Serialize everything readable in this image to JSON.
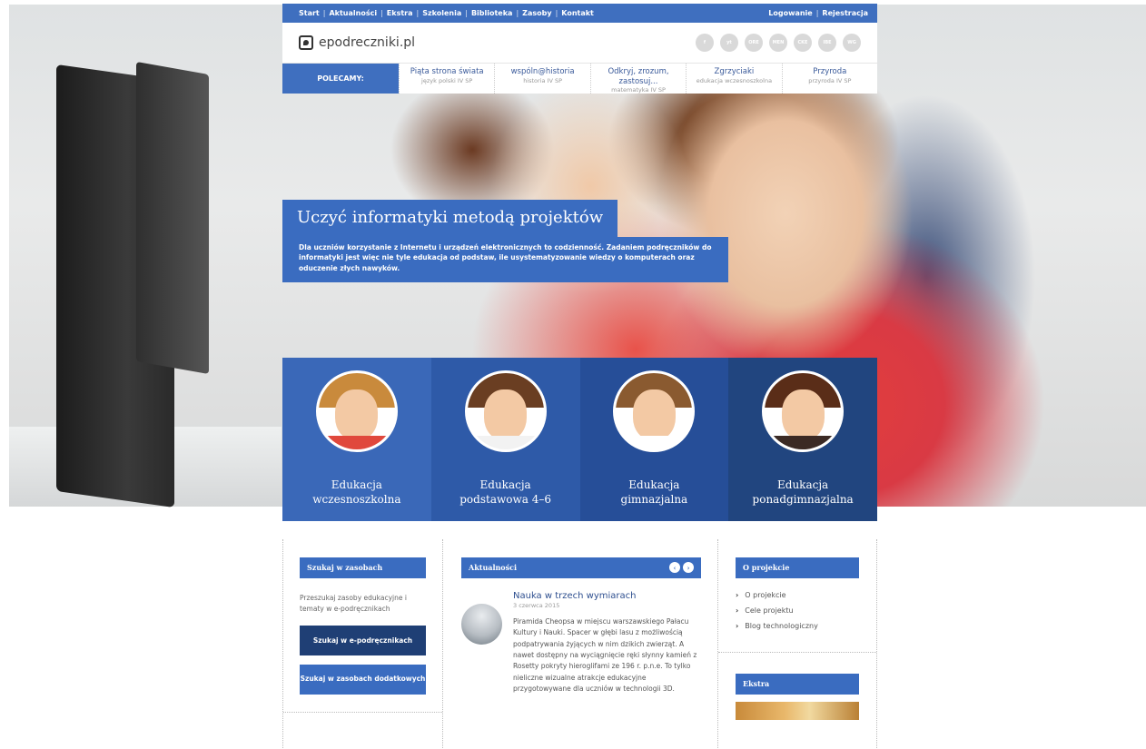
{
  "topbar": {
    "nav": [
      "Start",
      "Aktualności",
      "Ekstra",
      "Szkolenia",
      "Biblioteka",
      "Zasoby",
      "Kontakt"
    ],
    "separator": "|",
    "login": "Logowanie",
    "register": "Rejestracja"
  },
  "header": {
    "logo": "epodreczniki.pl",
    "social": [
      "f",
      "yt",
      "ORE",
      "MEN",
      "CKE",
      "IBE",
      "WG"
    ]
  },
  "recommend": {
    "label": "POLECAMY:",
    "items": [
      {
        "title": "Piąta strona świata",
        "sub": "język polski IV SP"
      },
      {
        "title": "wspóln@historia",
        "sub": "historia IV SP"
      },
      {
        "title": "Odkryj, zrozum, zastosuj...",
        "sub": "matematyka IV SP"
      },
      {
        "title": "Zgrzyciaki",
        "sub": "edukacja wczesnoszkolna"
      },
      {
        "title": "Przyroda",
        "sub": "przyroda IV SP"
      }
    ]
  },
  "hero": {
    "headline": "Uczyć informatyki metodą projektów",
    "lead": "Dla uczniów korzystanie z Internetu i urządzeń elektronicznych to codzienność. Zadaniem podręczników do informatyki jest więc nie tyle edukacja od podstaw, ile usystematyzowanie wiedzy o komputerach oraz oduczenie złych nawyków."
  },
  "education": [
    {
      "line1": "Edukacja",
      "line2": "wczesnoszkolna",
      "hair": "#c98a3c",
      "shirt": "#e0483c"
    },
    {
      "line1": "Edukacja",
      "line2": "podstawowa 4–6",
      "hair": "#6a3e22",
      "shirt": "#f2f2f2"
    },
    {
      "line1": "Edukacja",
      "line2": "gimnazjalna",
      "hair": "#8a5a30",
      "shirt": "#ffffff"
    },
    {
      "line1": "Edukacja",
      "line2": "ponadgimnazjalna",
      "hair": "#5a2d18",
      "shirt": "#3b2a24"
    }
  ],
  "search_box": {
    "title": "Szukaj w zasobach",
    "text": "Przeszukaj zasoby edukacyjne i tematy w e-podręcznikach",
    "btn_primary": "Szukaj w e-podręcznikach",
    "btn_secondary": "Szukaj w zasobach dodatkowych"
  },
  "news_box": {
    "title": "Aktualności",
    "prev": "‹",
    "next": "›",
    "item_title": "Nauka w trzech wymiarach",
    "item_date": "3 czerwca 2015",
    "item_body": "Piramida Cheopsa w miejscu warszawskiego Pałacu Kultury i Nauki. Spacer w głębi lasu z możliwością podpatrywania żyjących w nim dzikich zwierząt. A nawet dostępny na wyciągnięcie ręki słynny kamień z Rosetty pokryty hieroglifami ze 196 r. p.n.e. To tylko nieliczne wizualne atrakcje edukacyjne przygotowywane dla uczniów w technologii 3D."
  },
  "project_box": {
    "title": "O projekcie",
    "links": [
      "O projekcie",
      "Cele projektu",
      "Blog technologiczny"
    ],
    "chevron": "›"
  },
  "extra_box": {
    "title": "Ekstra"
  },
  "colors": {
    "primary": "#3f6fbf",
    "dark": "#1f3f75",
    "link": "#2e4f8f"
  }
}
